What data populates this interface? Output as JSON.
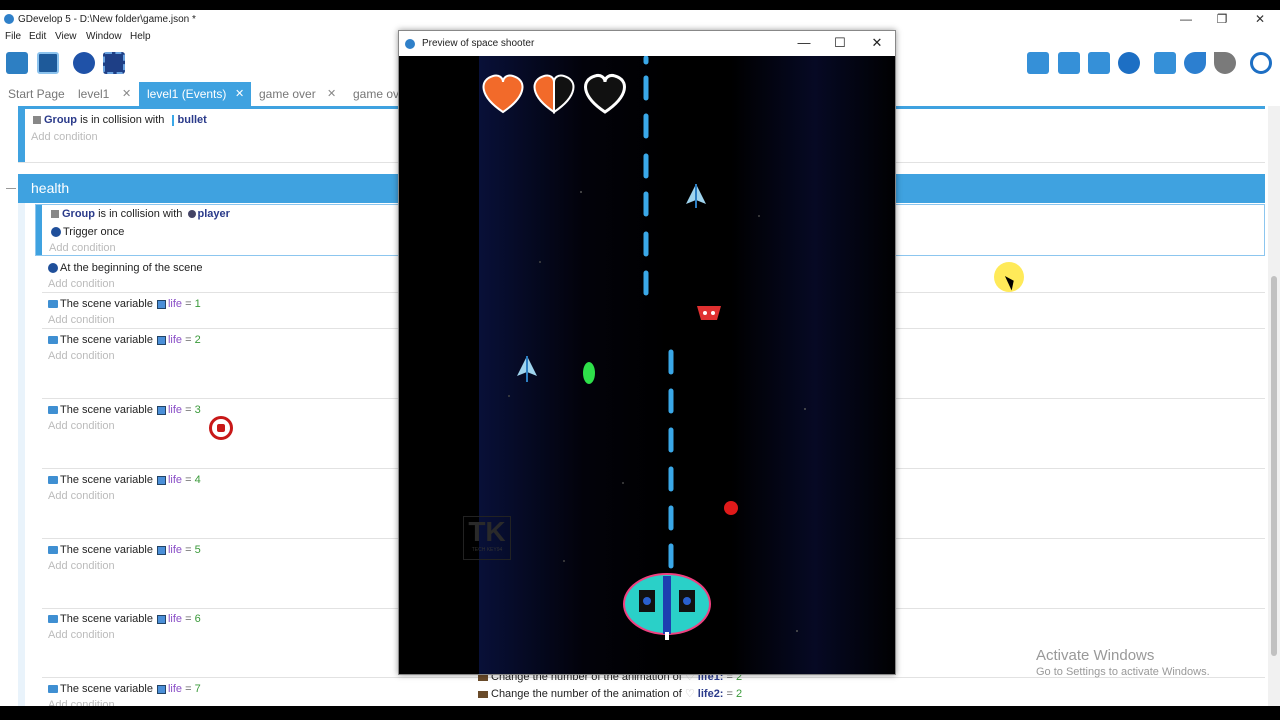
{
  "app": {
    "title": "GDevelop 5 - D:\\New folder\\game.json *",
    "menu": [
      "File",
      "Edit",
      "View",
      "Window",
      "Help"
    ],
    "window_controls": [
      "—",
      "❐",
      "✕"
    ]
  },
  "tabs": [
    {
      "label": "Start Page",
      "closable": false,
      "active": false
    },
    {
      "label": "level1",
      "closable": true,
      "active": false
    },
    {
      "label": "level1 (Events)",
      "closable": true,
      "active": true
    },
    {
      "label": "game over",
      "closable": true,
      "active": false
    },
    {
      "label": "game ov",
      "closable": false,
      "active": false
    }
  ],
  "events": {
    "add_condition": "Add condition",
    "first": {
      "object": "Group",
      "text": "is in collision with",
      "target": "bullet"
    },
    "group_name": "health",
    "collision": {
      "object": "Group",
      "text": "is in collision with",
      "target": "player",
      "trigger": "Trigger once"
    },
    "beginning": "At the beginning of the scene",
    "scene_var_text": "The scene variable",
    "var_name": "life",
    "eq": "=",
    "values": [
      "1",
      "2",
      "3",
      "4",
      "5",
      "6",
      "7"
    ]
  },
  "actions": [
    {
      "text": "Change the number of the animation of",
      "object": "life1:",
      "eq": "=",
      "value": "2"
    },
    {
      "text": "Change the number of the animation of",
      "object": "life2:",
      "eq": "=",
      "value": "2"
    }
  ],
  "preview": {
    "title": "Preview of space shooter",
    "controls": [
      "—",
      "☐",
      "✕"
    ],
    "hearts": [
      "full",
      "half",
      "empty"
    ],
    "watermark": {
      "big": "TK",
      "small": "TECH KEY94"
    }
  },
  "activate_windows": {
    "line1": "Activate Windows",
    "line2": "Go to Settings to activate Windows."
  },
  "colors": {
    "accent": "#3fa2e0",
    "heart": "#f26a2a",
    "laser": "#3aa8e8",
    "enemy_red": "#e03030",
    "green_bullet": "#2ee04a"
  }
}
